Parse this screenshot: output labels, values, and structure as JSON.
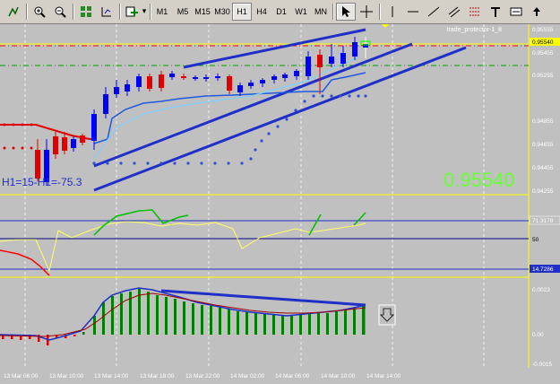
{
  "toolbar": {
    "timeframes": [
      "M1",
      "M5",
      "M15",
      "M30",
      "H1",
      "H4",
      "D1",
      "W1",
      "MN"
    ],
    "active_timeframe": "H1"
  },
  "main": {
    "indicator_label": "trade_protector-1_8",
    "current_price": "0.95540",
    "price_tag": "0.95540",
    "overlay_text": "H1=15-H1=-75.3",
    "price_axis": [
      "0.95555",
      "0.95455",
      "0.95255",
      "0.94855",
      "0.94655",
      "0.94455",
      "0.94255"
    ]
  },
  "rsi": {
    "levels": [
      "71.3178",
      "50",
      "14.7286"
    ]
  },
  "macd": {
    "axis": [
      "0.0023",
      "0.00",
      "-0.0015"
    ]
  },
  "time_axis": [
    "13 Mar 06:00",
    "13 Mar 10:00",
    "13 Mar 14:00",
    "13 Mar 18:00",
    "13 Mar 22:00",
    "14 Mar 02:00",
    "14 Mar 06:00",
    "14 Mar 10:00",
    "14 Mar 14:00"
  ],
  "colors": {
    "bg": "#c0c0c0",
    "bull": "#0000ff",
    "bear": "#ff0000",
    "trend": "#1f2fc8",
    "price_big": "#66ff33",
    "hist": "#008000"
  }
}
